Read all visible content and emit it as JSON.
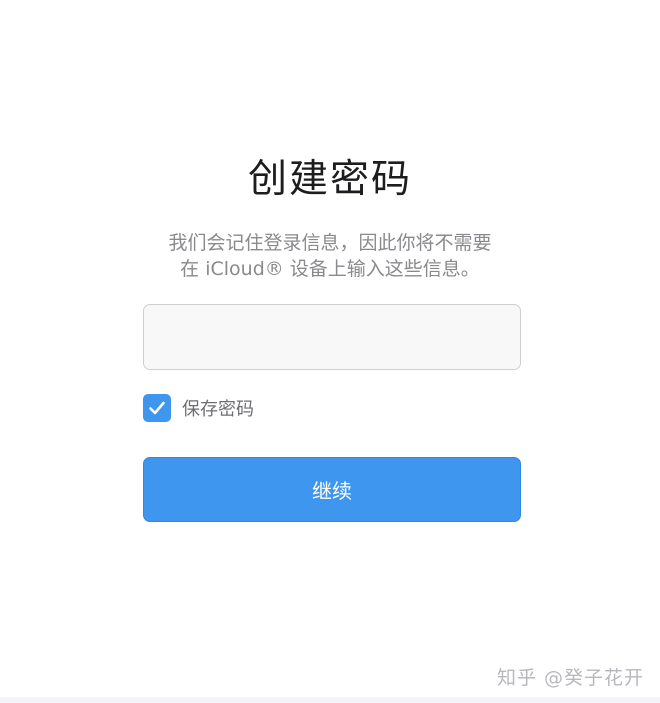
{
  "title": "创建密码",
  "description": {
    "line1": "我们会记住登录信息，因此你将不需要",
    "line2": "在 iCloud® 设备上输入这些信息。"
  },
  "password_field": {
    "value": "",
    "placeholder": ""
  },
  "save_password": {
    "checked": true,
    "label": "保存密码"
  },
  "continue_button": {
    "label": "继续"
  },
  "watermark": "知乎 @癸子花开",
  "colors": {
    "accent": "#3e96ee",
    "title_text": "#1d1d1f",
    "secondary_text": "#8a8a8e"
  },
  "icons": {
    "checkbox": "checkmark-icon"
  }
}
